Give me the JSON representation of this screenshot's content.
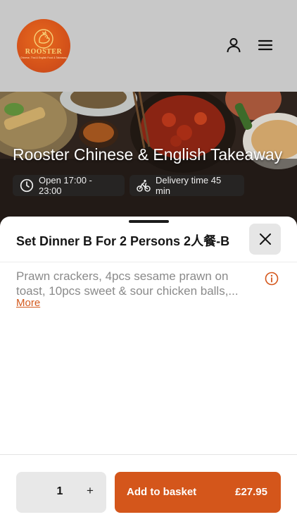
{
  "header": {
    "logo": {
      "name": "ROOSTER",
      "tagline": "Chinese, Thai & English Food & Takeaway"
    }
  },
  "hero": {
    "title": "Rooster Chinese & English Takeaway",
    "open_hours": "Open 17:00 - 23:00",
    "delivery_time": "Delivery time 45 min"
  },
  "item_sheet": {
    "title": "Set Dinner B For 2 Persons 2人餐-B",
    "description_lines": [
      "Prawn crackers, 4pcs sesame prawn on",
      "toast, 10pcs sweet & sour chicken balls,..."
    ],
    "more_label": "More",
    "quantity": "1",
    "plus_label": "+",
    "add_label": "Add to basket",
    "price": "£27.95"
  },
  "colors": {
    "accent": "#d4561b",
    "header_bg": "#c8c8c8",
    "muted_text": "#8a8a8a",
    "control_bg": "#e8e8e8"
  },
  "icons": [
    "user-icon",
    "menu-icon",
    "clock-icon",
    "bicycle-icon",
    "close-icon",
    "info-icon"
  ]
}
